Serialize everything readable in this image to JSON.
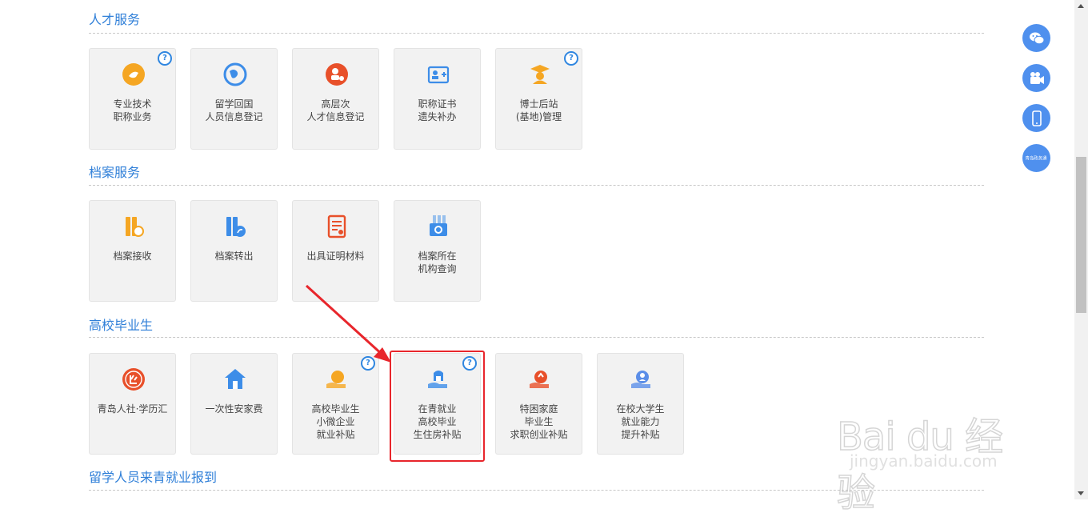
{
  "sections": [
    {
      "title": "人才服务",
      "tiles": [
        {
          "lines": [
            "专业技术",
            "职称业务"
          ],
          "icon": "professional-title-icon",
          "color": "#f5a623",
          "help": "?"
        },
        {
          "lines": [
            "留学回国",
            "人员信息登记"
          ],
          "icon": "globe-return-icon",
          "color": "#3d8de8",
          "help": ""
        },
        {
          "lines": [
            "高层次",
            "人才信息登记"
          ],
          "icon": "talent-award-icon",
          "color": "#e8502a",
          "help": ""
        },
        {
          "lines": [
            "职称证书",
            "遗失补办"
          ],
          "icon": "certificate-icon",
          "color": "#3d8de8",
          "help": ""
        },
        {
          "lines": [
            "博士后站",
            "(基地)管理"
          ],
          "icon": "doctor-cap-icon",
          "color": "#f5a623",
          "help": "?"
        }
      ]
    },
    {
      "title": "档案服务",
      "tiles": [
        {
          "lines": [
            "档案接收"
          ],
          "icon": "archive-receive-icon",
          "color": "#f5a623",
          "help": ""
        },
        {
          "lines": [
            "档案转出"
          ],
          "icon": "archive-transfer-icon",
          "color": "#3d8de8",
          "help": ""
        },
        {
          "lines": [
            "出具证明材料"
          ],
          "icon": "document-proof-icon",
          "color": "#e8502a",
          "help": ""
        },
        {
          "lines": [
            "档案所在",
            "机构查询"
          ],
          "icon": "archive-search-icon",
          "color": "#3d8de8",
          "help": ""
        }
      ]
    },
    {
      "title": "高校毕业生",
      "tiles": [
        {
          "lines": [
            "青岛人社·学历汇"
          ],
          "icon": "degree-hui-icon",
          "color": "#e8502a",
          "help": ""
        },
        {
          "lines": [
            "一次性安家费"
          ],
          "icon": "house-icon",
          "color": "#3d8de8",
          "help": ""
        },
        {
          "lines": [
            "高校毕业生",
            "小微企业",
            "就业补贴"
          ],
          "icon": "hand-coin-icon",
          "color": "#f5a623",
          "help": "?"
        },
        {
          "lines": [
            "在青就业",
            "高校毕业",
            "生住房补贴"
          ],
          "icon": "hand-house-icon",
          "color": "#3d8de8",
          "help": "?"
        },
        {
          "lines": [
            "特困家庭",
            "毕业生",
            "求职创业补贴"
          ],
          "icon": "hand-money-icon",
          "color": "#e8502a",
          "help": ""
        },
        {
          "lines": [
            "在校大学生",
            "就业能力",
            "提升补贴"
          ],
          "icon": "hand-person-icon",
          "color": "#5b8ee8",
          "help": ""
        }
      ]
    },
    {
      "title": "留学人员来青就业报到",
      "tiles": []
    }
  ],
  "sidebar": {
    "buttons": [
      {
        "name": "wechat-icon"
      },
      {
        "name": "video-icon"
      },
      {
        "name": "mobile-icon"
      },
      {
        "name": "qingdao-app-icon",
        "text": "青岛政务通"
      }
    ]
  },
  "watermark": {
    "brand": "Bai du 经验",
    "sub": "jingyan.baidu.com"
  },
  "colors": {
    "accent": "#2f7fd8",
    "highlight": "#e8262c",
    "help": "#2f86e0"
  }
}
